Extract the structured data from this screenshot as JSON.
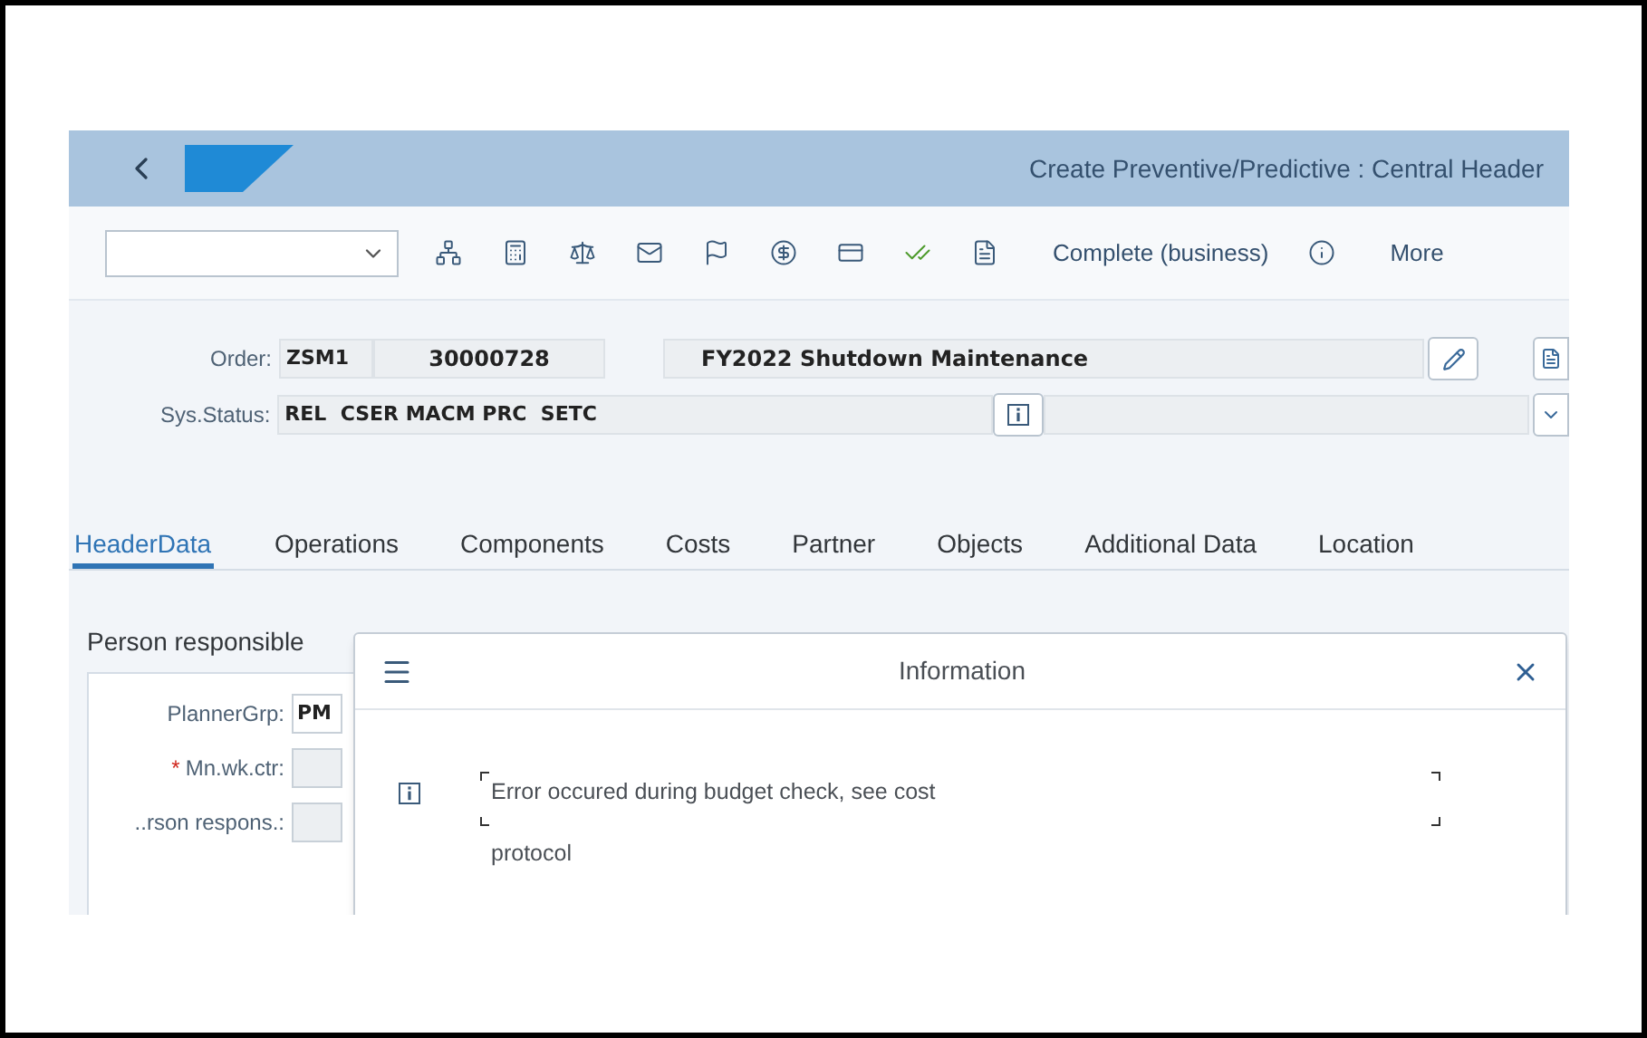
{
  "header": {
    "title": "Create Preventive/Predictive : Central Header"
  },
  "toolbar": {
    "items": [
      {
        "kind": "icon"
      },
      {
        "kind": "icon"
      },
      {
        "kind": "icon"
      },
      {
        "kind": "icon"
      },
      {
        "kind": "icon"
      },
      {
        "kind": "icon"
      },
      {
        "kind": "icon"
      },
      {
        "kind": "icon"
      },
      {
        "kind": "icon"
      },
      {
        "kind": "text",
        "label": "Complete (business)"
      },
      {
        "kind": "icon"
      },
      {
        "kind": "text",
        "label": "More"
      }
    ]
  },
  "order": {
    "label": "Order:",
    "type": "ZSM1",
    "number": "30000728",
    "description": "FY2022 Shutdown Maintenance"
  },
  "status": {
    "label": "Sys.Status:",
    "value": "REL  CSER MACM PRC  SETC"
  },
  "tabs": [
    {
      "label": "HeaderData",
      "selected": true
    },
    {
      "label": "Operations",
      "selected": false
    },
    {
      "label": "Components",
      "selected": false
    },
    {
      "label": "Costs",
      "selected": false
    },
    {
      "label": "Partner",
      "selected": false
    },
    {
      "label": "Objects",
      "selected": false
    },
    {
      "label": "Additional Data",
      "selected": false
    },
    {
      "label": "Location",
      "selected": false
    }
  ],
  "person_responsible": {
    "title": "Person responsible",
    "fields": [
      {
        "label": "PlannerGrp:",
        "value": "PM"
      },
      {
        "marker": "*",
        "label": "Mn.wk.ctr:"
      },
      {
        "label": "..rson respons.:"
      }
    ]
  },
  "dialog": {
    "title": "Information",
    "message": "Error occured during budget check, see cost protocol"
  }
}
